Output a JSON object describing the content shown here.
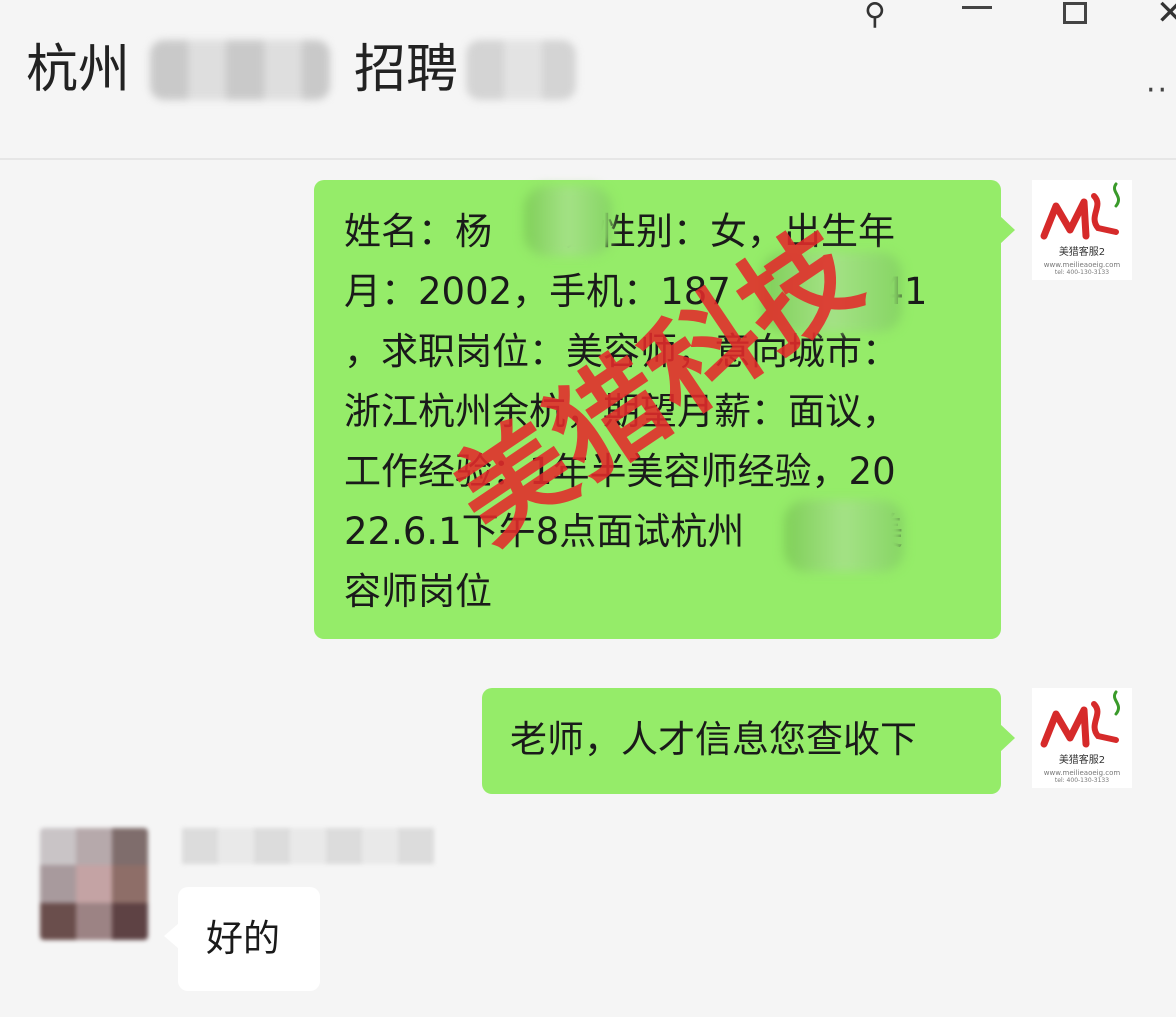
{
  "header": {
    "title_part1": "杭州",
    "title_part2": "招聘",
    "window_controls": [
      "pin-icon",
      "minimize-icon",
      "maximize-icon",
      "close-icon"
    ],
    "more_label": "··"
  },
  "messages": [
    {
      "direction": "sent",
      "lines": [
        "姓名：杨",
        "，性别：女，出生年",
        "月：2002，手机：187",
        "341",
        "，求职岗位：美容师，意向城市：",
        "浙江杭州余杭，期望月薪：面议，",
        "工作经验：1年半美容师经验，20",
        "22.6.1下午8点面试杭州",
        "美",
        "容师岗位"
      ]
    },
    {
      "direction": "sent",
      "text": "老师，人才信息您查收下"
    },
    {
      "direction": "received",
      "text": "好的"
    }
  ],
  "watermark": "美猎科技",
  "logo": {
    "mark": "ML",
    "caption": "美猎客服2",
    "url": "www.meilieaoeig.com",
    "phone": "tel: 400-130-3133"
  },
  "colors": {
    "sent_bubble": "#95ec69",
    "received_bubble": "#ffffff",
    "background": "#f5f5f5",
    "watermark": "#e22a2a",
    "logo_red": "#d62a2a",
    "logo_green": "#3a9a2a"
  }
}
